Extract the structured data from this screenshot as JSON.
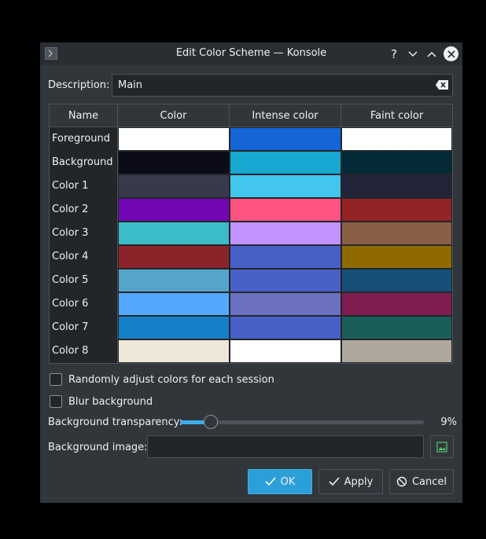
{
  "window": {
    "title": "Edit Color Scheme — Konsole",
    "controls": [
      "help-icon",
      "minimize-icon",
      "maximize-icon",
      "close-icon"
    ]
  },
  "description": {
    "label": "Description:",
    "value": "Main"
  },
  "table": {
    "headers": [
      "Name",
      "Color",
      "Intense color",
      "Faint color"
    ],
    "rows": [
      {
        "name": "Foreground",
        "color": "#ffffff",
        "intense": "#1565d8",
        "faint": "#ffffff"
      },
      {
        "name": "Background",
        "color": "#0b0c18",
        "intense": "#17a8d0",
        "faint": "#032a36"
      },
      {
        "name": "Color 1",
        "color": "#363a4a",
        "intense": "#43c6ee",
        "faint": "#23243a"
      },
      {
        "name": "Color 2",
        "color": "#7206b5",
        "intense": "#ff5281",
        "faint": "#932324"
      },
      {
        "name": "Color 3",
        "color": "#3cbcc6",
        "intense": "#c293fe",
        "faint": "#8b5e46"
      },
      {
        "name": "Color 4",
        "color": "#8c232b",
        "intense": "#4760c8",
        "faint": "#8e6a00"
      },
      {
        "name": "Color 5",
        "color": "#55a5cb",
        "intense": "#4760c8",
        "faint": "#174f77"
      },
      {
        "name": "Color 6",
        "color": "#53a7fc",
        "intense": "#6b71c0",
        "faint": "#7e1d50"
      },
      {
        "name": "Color 7",
        "color": "#1580c9",
        "intense": "#4760c8",
        "faint": "#1b5e59"
      },
      {
        "name": "Color 8",
        "color": "#eee6d6",
        "intense": "#ffffff",
        "faint": "#aea79c"
      }
    ]
  },
  "options": {
    "random_adjust": "Randomly adjust colors for each session",
    "blur_background": "Blur background"
  },
  "transparency": {
    "label": "Background transparency:",
    "value": "9%",
    "fraction": 0.09
  },
  "background_image": {
    "label": "Background image:",
    "value": ""
  },
  "buttons": {
    "ok": "OK",
    "apply": "Apply",
    "cancel": "Cancel"
  },
  "colors": {
    "accent": "#3daee9",
    "window_bg": "#31363b",
    "field_bg": "#232629",
    "border": "#4d5358"
  }
}
